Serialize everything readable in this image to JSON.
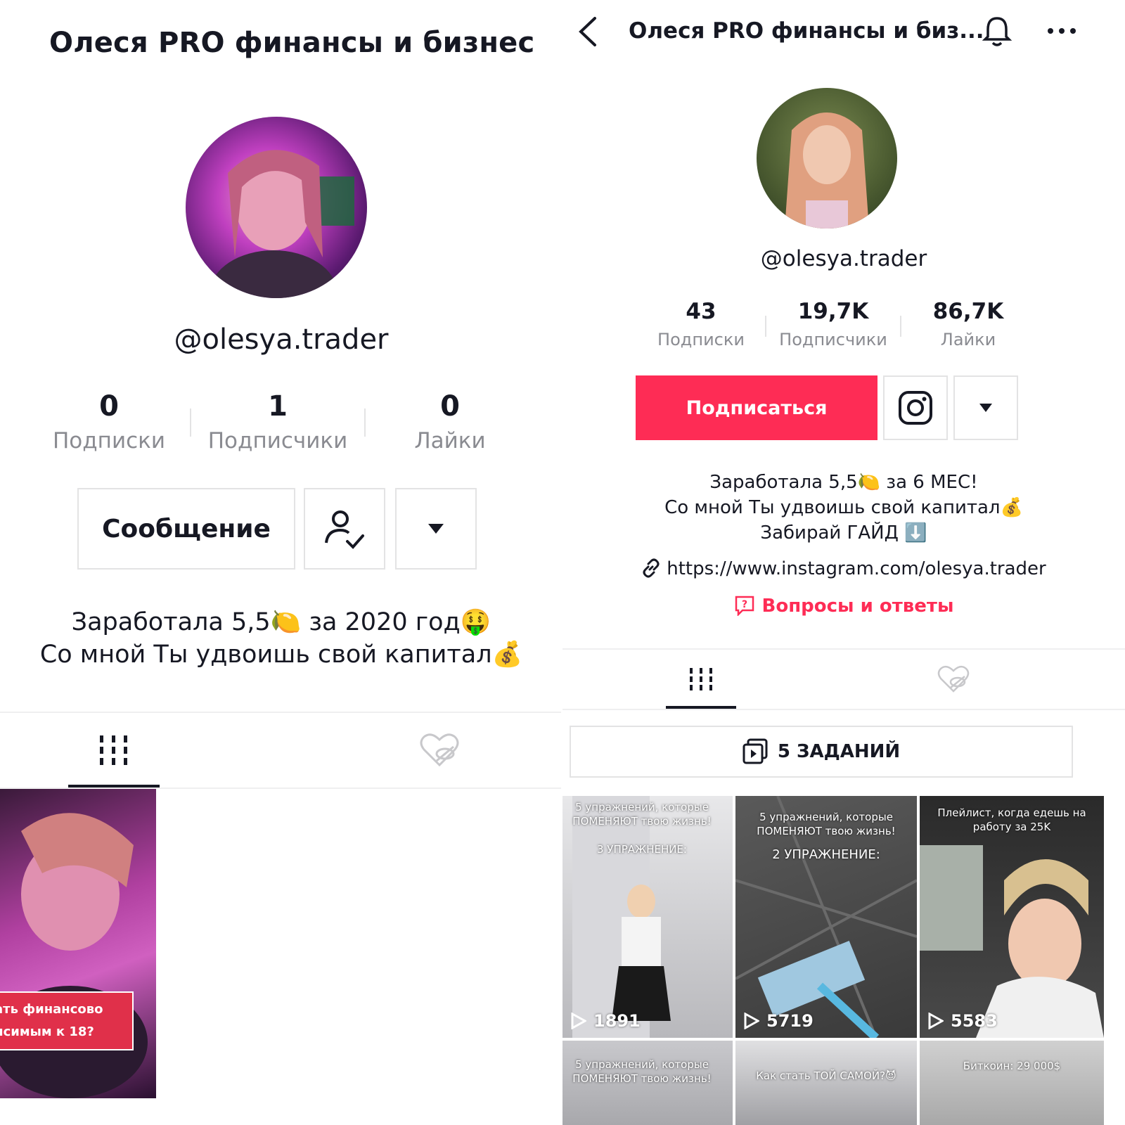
{
  "left": {
    "title": "Олеся PRO финансы и бизнес",
    "handle": "@olesya.trader",
    "stats": [
      {
        "value": "0",
        "label": "Подписки"
      },
      {
        "value": "1",
        "label": "Подписчики"
      },
      {
        "value": "0",
        "label": "Лайки"
      }
    ],
    "message_button": "Сообщение",
    "bio_line1": "Заработала 5,5🍋 за 2020 год🤑",
    "bio_line2": "Со мной Ты удвоишь свой капитал💰",
    "video_caption_line1": "ать финансово",
    "video_caption_line2": "исимым к 18?"
  },
  "right": {
    "title": "Олеся PRO финансы и биз...",
    "handle": "@olesya.trader",
    "stats": [
      {
        "value": "43",
        "label": "Подписки"
      },
      {
        "value": "19,7K",
        "label": "Подписчики"
      },
      {
        "value": "86,7K",
        "label": "Лайки"
      }
    ],
    "subscribe_button": "Подписаться",
    "bio_line1": "Заработала 5,5🍋 за 6 МЕС!",
    "bio_line2": "Со мной Ты удвоишь свой капитал💰",
    "bio_line3": "Забирай ГАЙД ⬇️",
    "link": "https://www.instagram.com/olesya.trader",
    "qa_label": "Вопросы и ответы",
    "playlist_label": "5 ЗАДАНИЙ",
    "videos": [
      {
        "caption": "5 упражнений, которые ПОМЕНЯЮТ твою жизнь!",
        "sub": "3 УПРАЖНЕНИЕ:",
        "views": "1891"
      },
      {
        "caption": "5 упражнений, которые ПОМЕНЯЮТ твою жизнь!",
        "sub": "2 УПРАЖНЕНИЕ:",
        "views": "5719"
      },
      {
        "caption": "Плейлист, когда едешь на работу за 25K",
        "sub": "",
        "views": "5583"
      },
      {
        "caption": "5 упражнений, которые ПОМЕНЯЮТ твою жизнь!",
        "sub": "",
        "views": ""
      },
      {
        "caption": "Как стать ТОЙ САМОЙ?😈",
        "sub": "",
        "views": ""
      },
      {
        "caption": "Биткоин: 29 000$",
        "sub": "",
        "views": ""
      }
    ]
  },
  "colors": {
    "accent": "#fe2c55",
    "text": "#161823",
    "muted": "#8a8b91",
    "border": "#e3e3e4"
  }
}
